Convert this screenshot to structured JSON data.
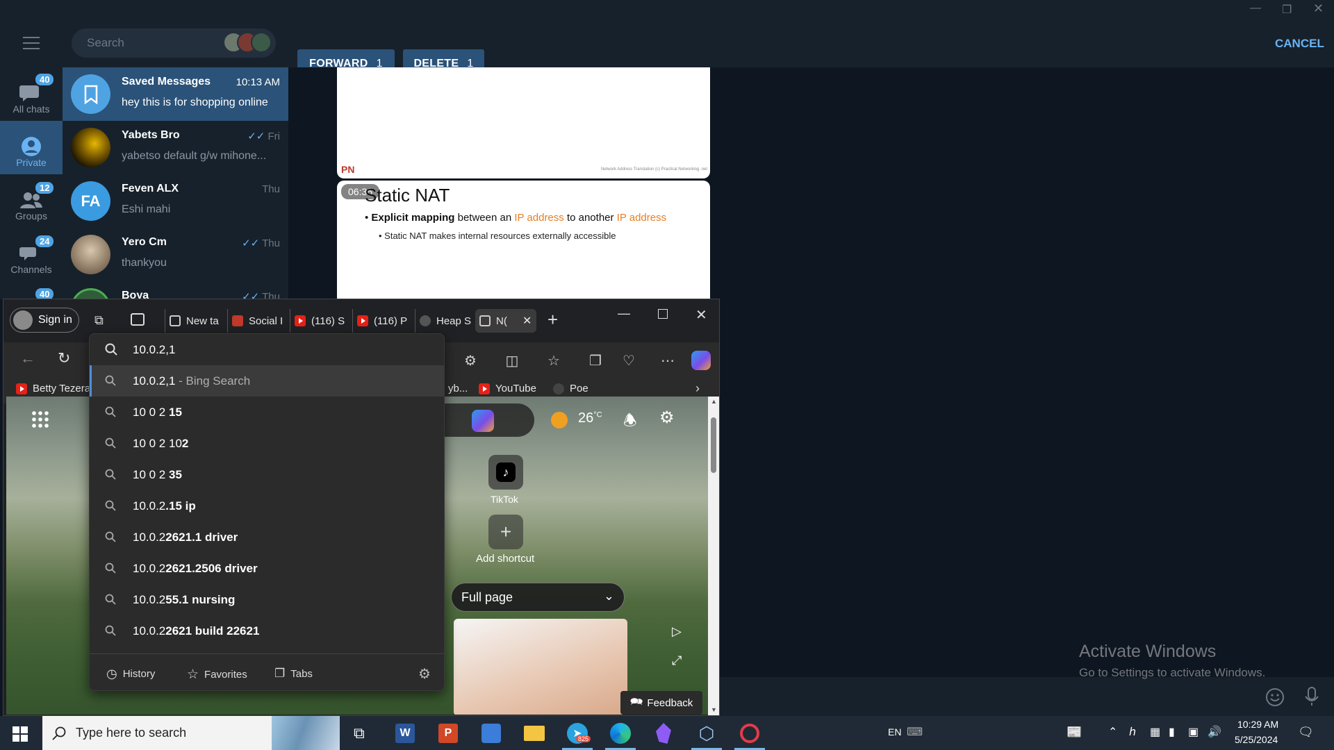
{
  "telegram": {
    "search_placeholder": "Search",
    "forward_label": "FORWARD",
    "forward_count": "1",
    "delete_label": "DELETE",
    "delete_count": "1",
    "cancel_label": "CANCEL",
    "rail": [
      {
        "label": "All chats",
        "badge": "40"
      },
      {
        "label": "Private",
        "badge": ""
      },
      {
        "label": "Groups",
        "badge": "12"
      },
      {
        "label": "Channels",
        "badge": "24"
      },
      {
        "label": "",
        "badge": "40"
      }
    ],
    "chats": [
      {
        "name": "Saved Messages",
        "time": "10:13 AM",
        "message": "hey this is for shopping online"
      },
      {
        "name": "Yabets Bro",
        "time": "Fri",
        "message": "yabetso default g/w mihone..."
      },
      {
        "name": "Feven ALX",
        "initials": "FA",
        "time": "Thu",
        "message": "Eshi mahi"
      },
      {
        "name": "Yero Cm",
        "time": "Thu",
        "message": "thankyou"
      },
      {
        "name": "Boya",
        "time": "Thu",
        "message": ""
      }
    ],
    "slide1": {
      "logo": "PN",
      "footer": "Network Address Translation    (c) Practical Networking .net"
    },
    "slide2": {
      "time_badge": "06:36",
      "title": "Static NAT",
      "bullet1_bold": "Explicit mapping",
      "bullet1_mid1": " between an ",
      "bullet1_hl1": "IP address",
      "bullet1_mid2": " to another ",
      "bullet1_hl2": "IP address",
      "bullet2": "Static NAT makes internal resources externally accessible"
    },
    "accent": "#2b5278",
    "highlight_color": "#e67e22"
  },
  "edge": {
    "sign_in": "Sign in",
    "tabs": [
      {
        "label": "New ta"
      },
      {
        "label": "Social I"
      },
      {
        "label": "(116) S"
      },
      {
        "label": "(116) P"
      },
      {
        "label": "Heap S"
      },
      {
        "label": "N("
      }
    ],
    "address_value": "10.0.2,1",
    "favorites": [
      {
        "label": "Betty Tezera"
      },
      {
        "label": "yb..."
      },
      {
        "label": "YouTube"
      },
      {
        "label": "Poe"
      }
    ],
    "suggestions": [
      {
        "pre": "10.0.2,1",
        "post": " - Bing Search"
      },
      {
        "pre": "10 0 2 ",
        "bold": "15"
      },
      {
        "pre": "10 0 2 10",
        "bold": "2"
      },
      {
        "pre": "10 0 2 ",
        "bold": "35"
      },
      {
        "pre": "10.0.2",
        "bold": ".15 ip"
      },
      {
        "pre": "10.0.2",
        "bold": "2621.1 driver"
      },
      {
        "pre": "10.0.2",
        "bold": "2621.2",
        "post_bold": "506 driver"
      },
      {
        "pre": "10.0.2",
        "bold": "55.1 nursing"
      },
      {
        "pre": "10.0.2",
        "bold": "2621 build 22621"
      }
    ],
    "footer": {
      "history": "History",
      "favorites": "Favorites",
      "tabs": "Tabs"
    },
    "page": {
      "weather": "26",
      "weather_unit": "°C",
      "shortcut_tiktok": "TikTok",
      "add_shortcut": "Add shortcut",
      "layout_select": "Full page",
      "feedback": "Feedback"
    }
  },
  "watermark": {
    "title": "Activate Windows",
    "subtitle": "Go to Settings to activate Windows."
  },
  "taskbar": {
    "search_placeholder": "Type here to search",
    "language": "EN",
    "time": "10:29 AM",
    "date": "5/25/2024",
    "telegram_badge": "825"
  }
}
